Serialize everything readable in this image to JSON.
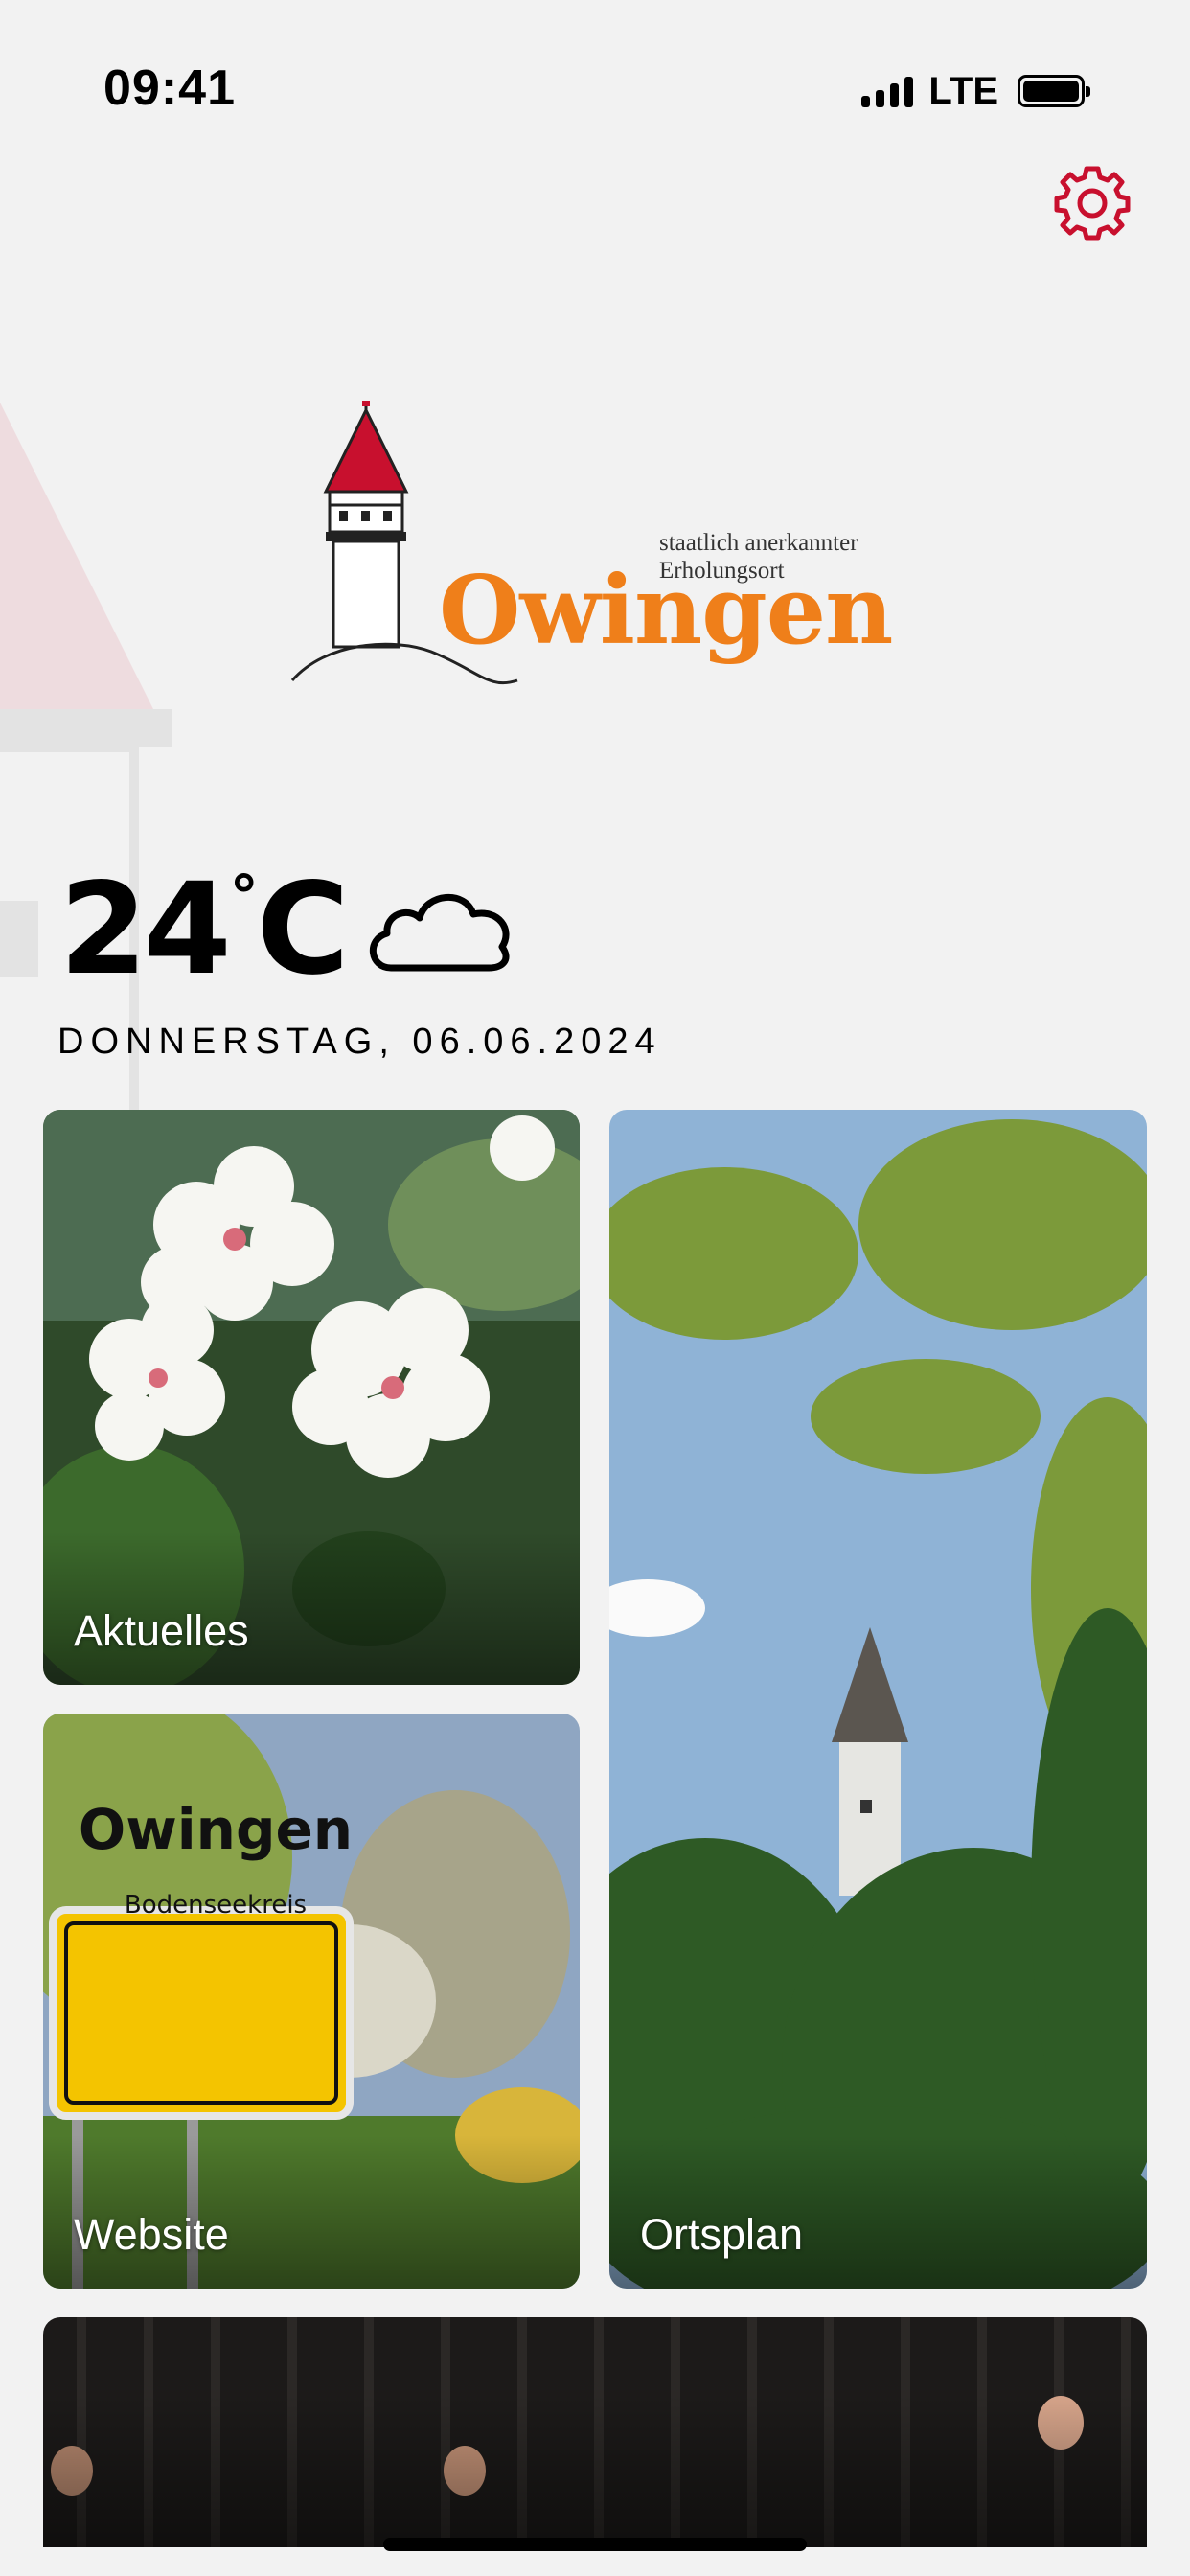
{
  "status_bar": {
    "time": "09:41",
    "network": "LTE"
  },
  "header": {
    "settings_icon": "gear-icon",
    "accent_color": "#c8102e"
  },
  "logo": {
    "subtitle_line1": "staatlich anerkannter",
    "subtitle_line2": "Erholungsort",
    "name": "Owingen",
    "name_color": "#ef7f1a"
  },
  "weather": {
    "temperature": "24",
    "degree_symbol": "°",
    "unit": "C",
    "condition_icon": "cloud-icon",
    "date": "DONNERSTAG, 06.06.2024"
  },
  "tiles": [
    {
      "label": "Aktuelles",
      "image": "blossom-photo"
    },
    {
      "label": "Ortsplan",
      "image": "tower-photo"
    },
    {
      "label": "Website",
      "image": "town-sign-photo"
    },
    {
      "label": "",
      "image": "concert-photo"
    }
  ],
  "sign": {
    "town": "Owingen",
    "district": "Bodenseekreis"
  }
}
